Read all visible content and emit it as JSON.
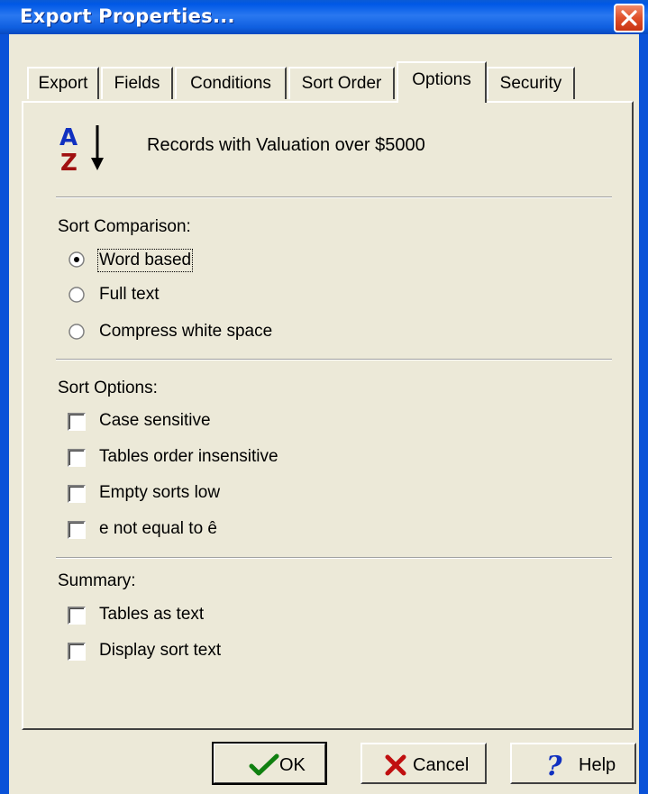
{
  "window": {
    "title": "Export Properties..."
  },
  "tabs": [
    {
      "label": "Export"
    },
    {
      "label": "Fields"
    },
    {
      "label": "Conditions"
    },
    {
      "label": "Sort Order"
    },
    {
      "label": "Options"
    },
    {
      "label": "Security"
    }
  ],
  "active_tab": "Options",
  "header": {
    "icon": "sort-az-icon",
    "text": "Records with Valuation over $5000"
  },
  "sort_comparison": {
    "label": "Sort Comparison:",
    "options": [
      {
        "label": "Word based",
        "selected": true
      },
      {
        "label": "Full text",
        "selected": false
      },
      {
        "label": "Compress white space",
        "selected": false
      }
    ]
  },
  "sort_options": {
    "label": "Sort Options:",
    "items": [
      {
        "label": "Case sensitive",
        "checked": false
      },
      {
        "label": "Tables order insensitive",
        "checked": false
      },
      {
        "label": "Empty sorts low",
        "checked": false
      },
      {
        "label": "e not equal to ê",
        "checked": false
      }
    ]
  },
  "summary": {
    "label": "Summary:",
    "items": [
      {
        "label": "Tables as text",
        "checked": false
      },
      {
        "label": "Display sort text",
        "checked": false
      }
    ]
  },
  "buttons": {
    "ok": {
      "label": "OK",
      "icon": "checkmark-icon"
    },
    "cancel": {
      "label": "Cancel",
      "icon": "x-icon"
    },
    "help": {
      "label": "Help",
      "icon": "question-icon"
    }
  },
  "colors": {
    "title_bar": "#0058e6",
    "dialog_bg": "#ece9d8",
    "close_red": "#e0502a"
  }
}
